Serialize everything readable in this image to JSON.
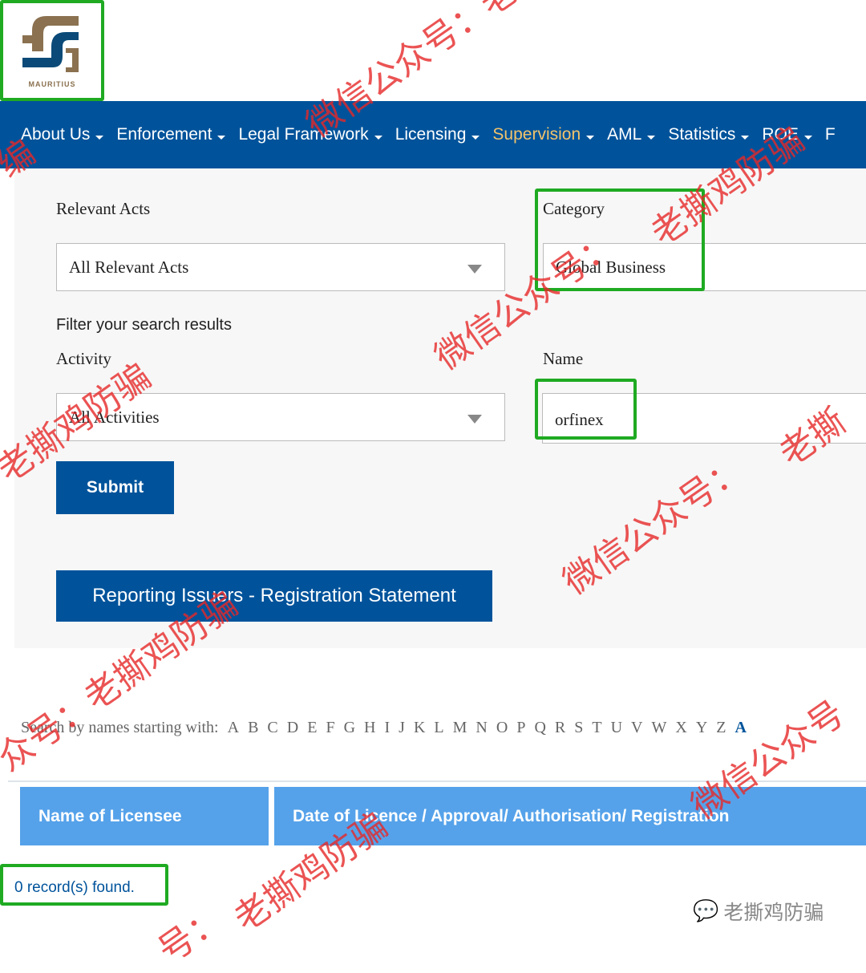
{
  "logo": {
    "text": "MAURITIUS",
    "colors": {
      "gold": "#8b7150",
      "blue": "#0b4a78"
    }
  },
  "nav": {
    "items": [
      {
        "label": "About Us",
        "active": false
      },
      {
        "label": "Enforcement",
        "active": false
      },
      {
        "label": "Legal Framework",
        "active": false
      },
      {
        "label": "Licensing",
        "active": false
      },
      {
        "label": "Supervision",
        "active": true
      },
      {
        "label": "AML",
        "active": false
      },
      {
        "label": "Statistics",
        "active": false
      },
      {
        "label": "ROE",
        "active": false
      },
      {
        "label": "F",
        "active": false
      }
    ],
    "colors": {
      "background": "#00539b",
      "active": "#f3c36b"
    }
  },
  "form": {
    "relevant_acts_label": "Relevant Acts",
    "relevant_acts_value": "All Relevant Acts",
    "category_label": "Category",
    "category_value": "Global Business",
    "filter_label": "Filter your search results",
    "activity_label": "Activity",
    "activity_value": "All Activities",
    "name_label": "Name",
    "name_value": "orfinex",
    "submit_label": "Submit",
    "reporting_label": "Reporting Issuers - Registration Statement"
  },
  "alpha": {
    "label": "Search by names starting with:",
    "letters": [
      "A",
      "B",
      "C",
      "D",
      "E",
      "F",
      "G",
      "H",
      "I",
      "J",
      "K",
      "L",
      "M",
      "N",
      "O",
      "P",
      "Q",
      "R",
      "S",
      "T",
      "U",
      "V",
      "W",
      "X",
      "Y",
      "Z",
      "A"
    ]
  },
  "table": {
    "headers": [
      "Name of Licensee",
      "Date of Licence / Approval/ Authorisation/ Registration"
    ],
    "header_color": "#55a2ea"
  },
  "results": {
    "text": "0 record(s) found."
  },
  "watermarks": {
    "texts": [
      "微信公众号：老",
      "编",
      "老撕鸡防骗",
      "微信公众号：",
      "老撕鸡防骗",
      "老撕",
      "微信公众号：",
      "众号：老撕鸡防骗",
      "微信公众号",
      "老撕鸡防骗",
      "号："
    ],
    "footer": "老撕鸡防骗",
    "highlight_color": "#1faa22"
  }
}
